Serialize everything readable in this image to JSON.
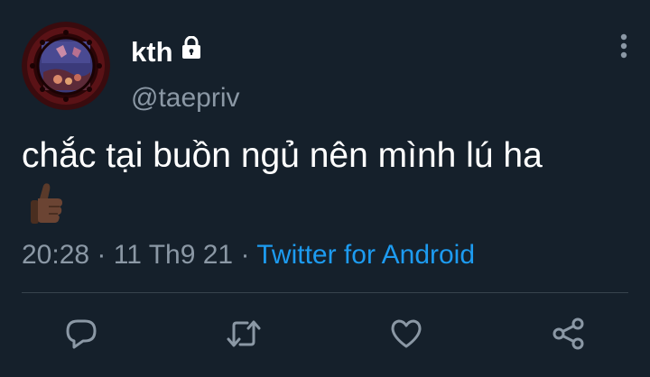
{
  "user": {
    "display_name": "kth",
    "handle": "@taepriv",
    "protected": true
  },
  "tweet": {
    "text": "chắc tại buồn ngủ nên mình lú ha",
    "emoji": "thumbs-up (dark skin tone)",
    "time": "20:28",
    "separator": "·",
    "date": "11 Th9 21",
    "source": "Twitter for Android"
  },
  "actions": [
    "reply-icon",
    "retweet-icon",
    "like-icon",
    "share-icon"
  ],
  "colors": {
    "background": "#15202b",
    "text": "#ffffff",
    "secondary": "#8b98a5",
    "link": "#1d9bf0",
    "divider": "#38444d"
  }
}
